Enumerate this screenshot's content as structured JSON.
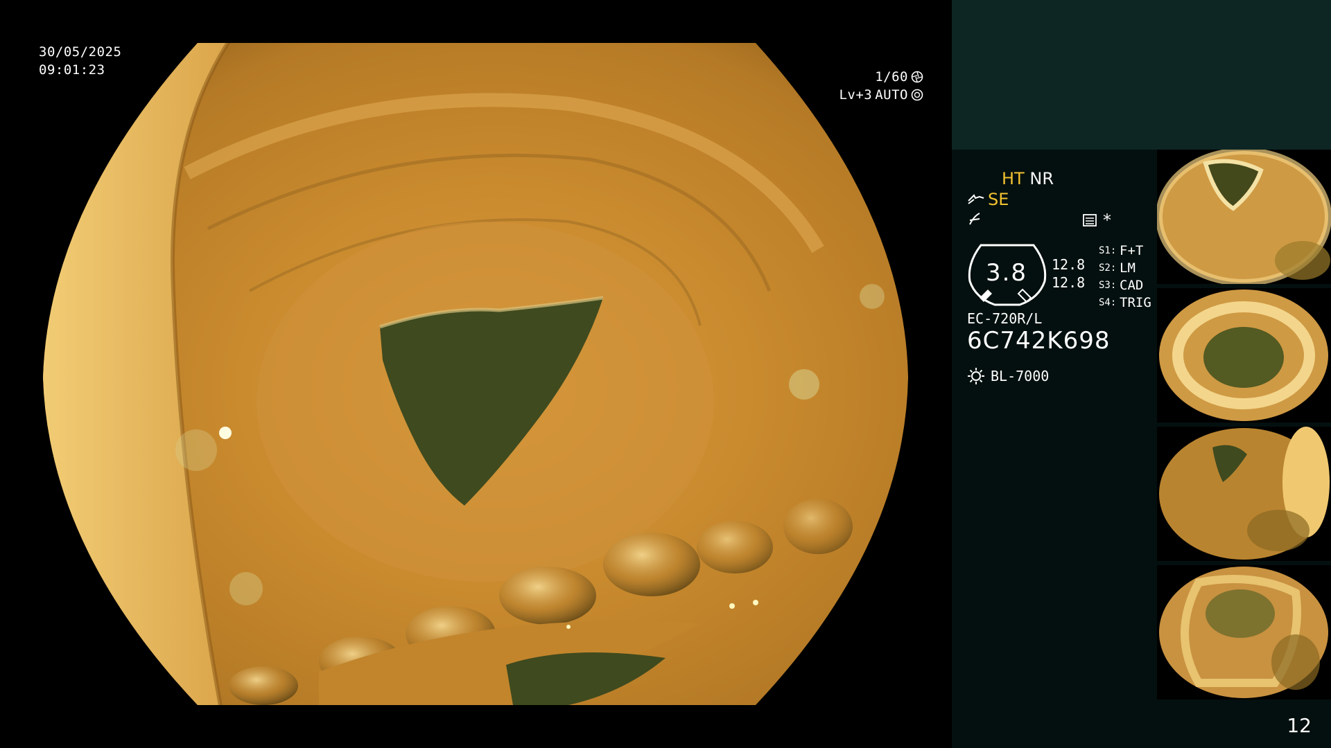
{
  "osd": {
    "date": "30/05/2025",
    "time": "09:01:23",
    "shutter": "1/60",
    "level": "Lv+3",
    "iris_mode": "AUTO"
  },
  "panel": {
    "mode_ht": "HT",
    "mode_nr": "NR",
    "mode_se": "SE",
    "asterisk": "*",
    "gauge_value": "3.8",
    "gauge_side_top": "12.8",
    "gauge_side_bottom": "12.8",
    "switches": [
      {
        "key": "S1:",
        "value": "F+T"
      },
      {
        "key": "S2:",
        "value": "LM"
      },
      {
        "key": "S3:",
        "value": "CAD"
      },
      {
        "key": "S4:",
        "value": "TRIG"
      }
    ],
    "scope_model": "EC-720R/L",
    "scope_serial": "6C742K698",
    "light_source": "BL-7000",
    "page_number": "12"
  },
  "colors": {
    "mucosa_light": "#e9b95c",
    "mucosa_mid": "#c98a2e",
    "lumen": "#3f4a1e",
    "mode_accent": "#f2c230",
    "panel_bg": "#04100f",
    "panel_header": "#0d2624"
  },
  "icons": {
    "shutter": "aperture-icon",
    "iris": "iris-icon",
    "enhance": "structure-enhance-icon",
    "color": "color-tone-icon",
    "memory": "memory-icon",
    "light": "light-source-icon"
  }
}
